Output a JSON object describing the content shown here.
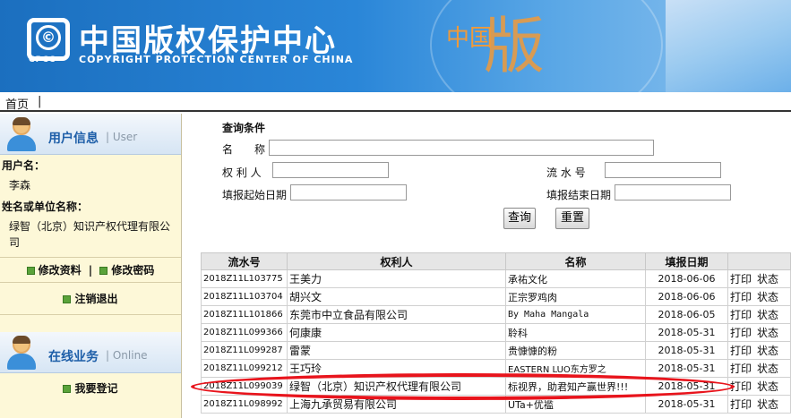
{
  "header": {
    "logo_abbr": "CPCC",
    "title_cn": "中国版权保护中心",
    "title_en": "COPYRIGHT PROTECTION CENTER OF CHINA",
    "deco_small": "中国",
    "deco_big": "版"
  },
  "nav": {
    "home": "首页",
    "separator": "|"
  },
  "sidebar": {
    "user_section": {
      "title": "用户信息",
      "subtitle": "| User"
    },
    "username_label": "用户名：",
    "username_value": "李森",
    "org_label": "姓名或单位名称：",
    "org_value": "绿智（北京）知识产权代理有限公司",
    "edit_profile": "修改资料",
    "link_sep": "|",
    "change_password": "修改密码",
    "logout": "注销退出",
    "online_section": {
      "title": "在线业务",
      "subtitle": "| Online"
    },
    "register": "我要登记"
  },
  "search": {
    "title": "查询条件",
    "name_label": "名　　称",
    "name_value": "",
    "owner_label": "权 利 人",
    "owner_value": "",
    "serial_label": "流 水 号",
    "serial_value": "",
    "start_date_label": "填报起始日期",
    "start_date_value": "",
    "end_date_label": "填报结束日期",
    "end_date_value": "",
    "query_button": "查询",
    "reset_button": "重置"
  },
  "table": {
    "headers": {
      "serial": "流水号",
      "owner": "权利人",
      "name": "名称",
      "date": "填报日期",
      "actions": ""
    },
    "action_print": "打印",
    "action_status": "状态",
    "rows": [
      {
        "serial": "2018Z11L103775",
        "owner": "王美力",
        "name": "承祐文化",
        "date": "2018-06-06"
      },
      {
        "serial": "2018Z11L103704",
        "owner": "胡兴文",
        "name": "正宗罗鸡肉",
        "date": "2018-06-06"
      },
      {
        "serial": "2018Z11L101866",
        "owner": "东莞市中立食品有限公司",
        "name": "By Maha Mangala",
        "date": "2018-06-05"
      },
      {
        "serial": "2018Z11L099366",
        "owner": "何康康",
        "name": "聆科",
        "date": "2018-05-31"
      },
      {
        "serial": "2018Z11L099287",
        "owner": "雷蒙",
        "name": "贵慷慷的粉",
        "date": "2018-05-31"
      },
      {
        "serial": "2018Z11L099212",
        "owner": "王巧玲",
        "name": "EASTERN LUO东方罗之",
        "date": "2018-05-31"
      },
      {
        "serial": "2018Z11L099039",
        "owner": "绿智（北京）知识产权代理有限公司",
        "name": "标视界，助君知产赢世界!!!",
        "date": "2018-05-31"
      },
      {
        "serial": "2018Z11L098992",
        "owner": "上海九承贸易有限公司",
        "name": "UTa+优褴",
        "date": "2018-05-31"
      }
    ]
  },
  "colors": {
    "header_blue": "#1b6fbf",
    "sidebar_bg": "#fdf8d8",
    "highlight": "#e8141c",
    "accent_orange": "#f09a3a"
  }
}
